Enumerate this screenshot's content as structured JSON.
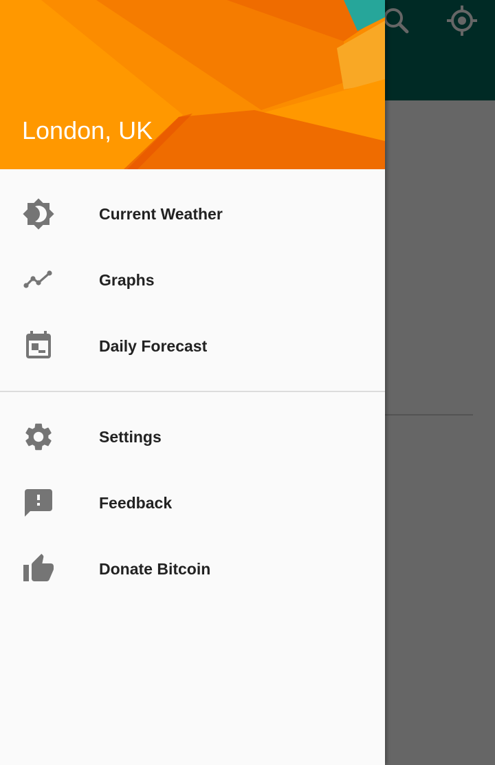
{
  "header": {
    "location": "London, UK"
  },
  "colors": {
    "toolbar": "#00695c",
    "header_orange": "#fb8c00",
    "icon_grey": "#757575",
    "label": "#222222",
    "drawer_bg": "#fafafa"
  },
  "toolbar": {
    "search_icon": "search-icon",
    "locate_icon": "my-location-icon"
  },
  "menu": {
    "primary": [
      {
        "label": "Current Weather",
        "icon": "brightness-icon"
      },
      {
        "label": "Graphs",
        "icon": "timeline-icon"
      },
      {
        "label": "Daily Forecast",
        "icon": "calendar-icon"
      }
    ],
    "secondary": [
      {
        "label": "Settings",
        "icon": "gear-icon"
      },
      {
        "label": "Feedback",
        "icon": "feedback-icon"
      },
      {
        "label": "Donate Bitcoin",
        "icon": "thumb-up-icon"
      }
    ]
  }
}
